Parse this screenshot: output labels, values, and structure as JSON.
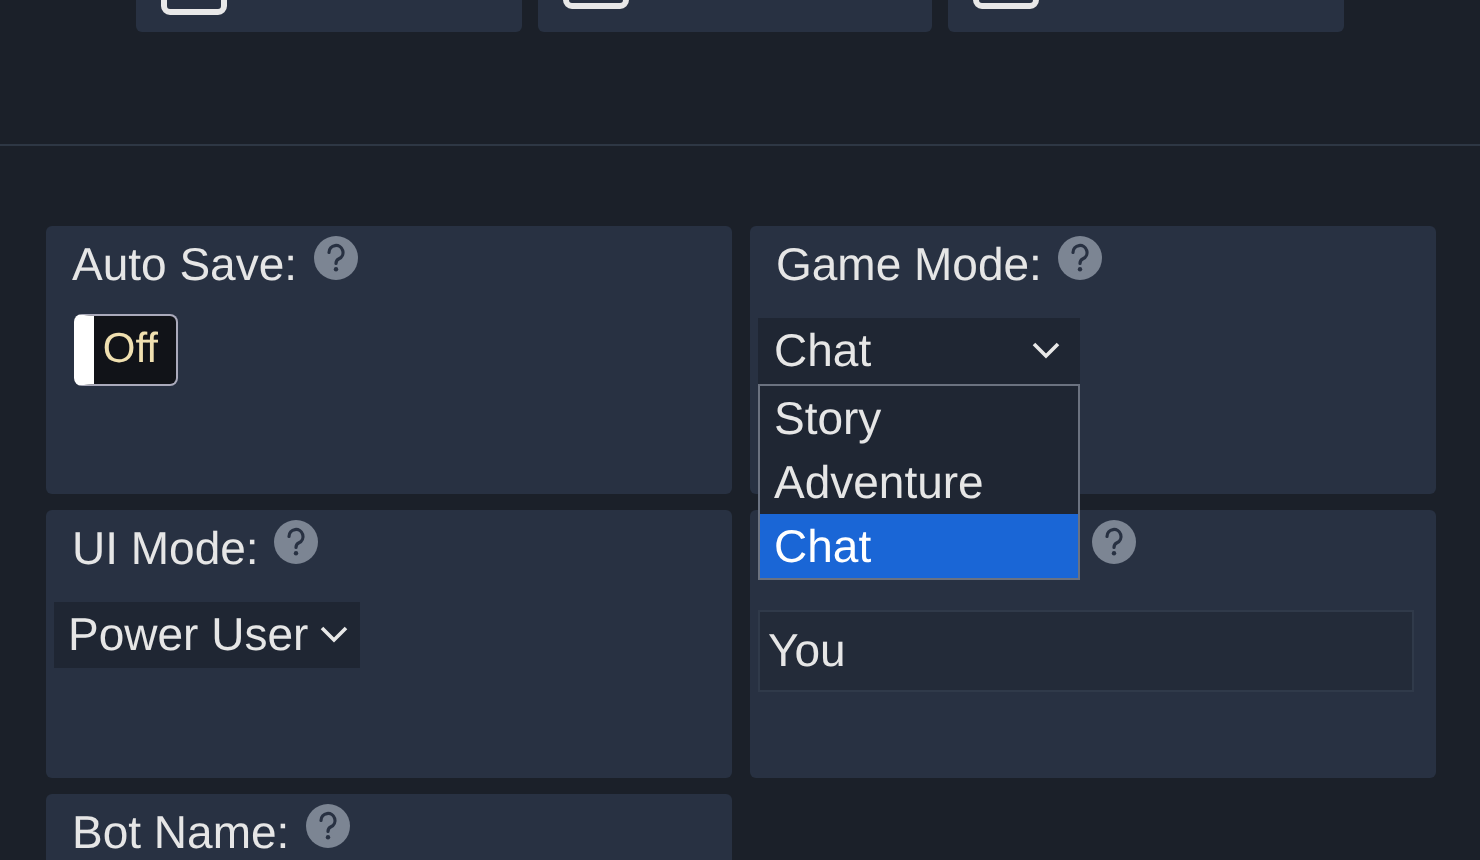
{
  "toolbar": {
    "buttons": [
      {
        "kind": "button"
      },
      {
        "kind": "button"
      },
      {
        "kind": "button"
      }
    ]
  },
  "settings": [
    {
      "kind": "toggle",
      "label": "Auto Save:",
      "on": false,
      "state_text": "Off"
    },
    {
      "kind": "select",
      "label": "Game Mode:",
      "value": "Chat",
      "expanded": true,
      "options": [
        {
          "label": "Story",
          "selected": false
        },
        {
          "label": "Adventure",
          "selected": false
        },
        {
          "label": "Chat",
          "selected": true
        }
      ]
    },
    {
      "kind": "select",
      "label": "UI Mode:",
      "value": "Power User",
      "expanded": false
    },
    {
      "kind": "text",
      "value": "You"
    },
    {
      "kind": "label",
      "label": "Bot Name:"
    }
  ]
}
